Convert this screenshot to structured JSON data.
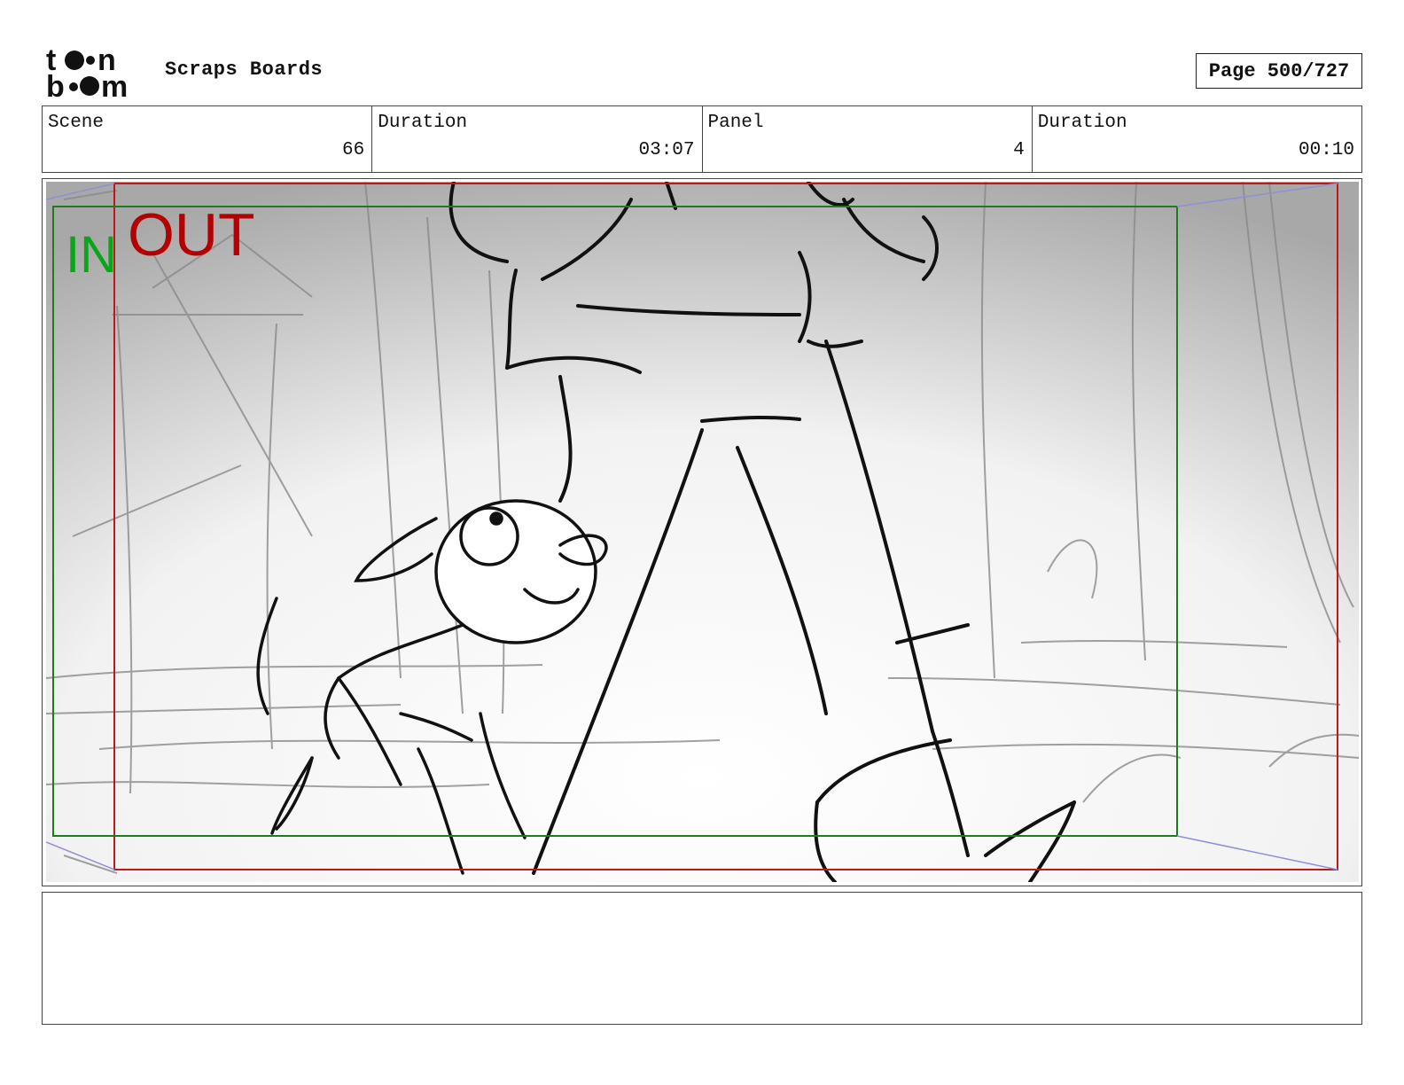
{
  "header": {
    "logo_text_top": "toon",
    "logo_text_bottom": "boom",
    "project_title": "Scraps Boards",
    "page_label": "Page 500/727"
  },
  "info": {
    "scene_label": "Scene",
    "scene_value": "66",
    "scene_duration_label": "Duration",
    "scene_duration_value": "03:07",
    "panel_label": "Panel",
    "panel_value": "4",
    "panel_duration_label": "Duration",
    "panel_duration_value": "00:10"
  },
  "panel": {
    "in_label": "IN",
    "out_label": "OUT",
    "in_color": "#0aa51a",
    "out_color": "#b30000",
    "image_description_icon": "storyboard-sketch-image"
  },
  "notes": {
    "text": ""
  }
}
